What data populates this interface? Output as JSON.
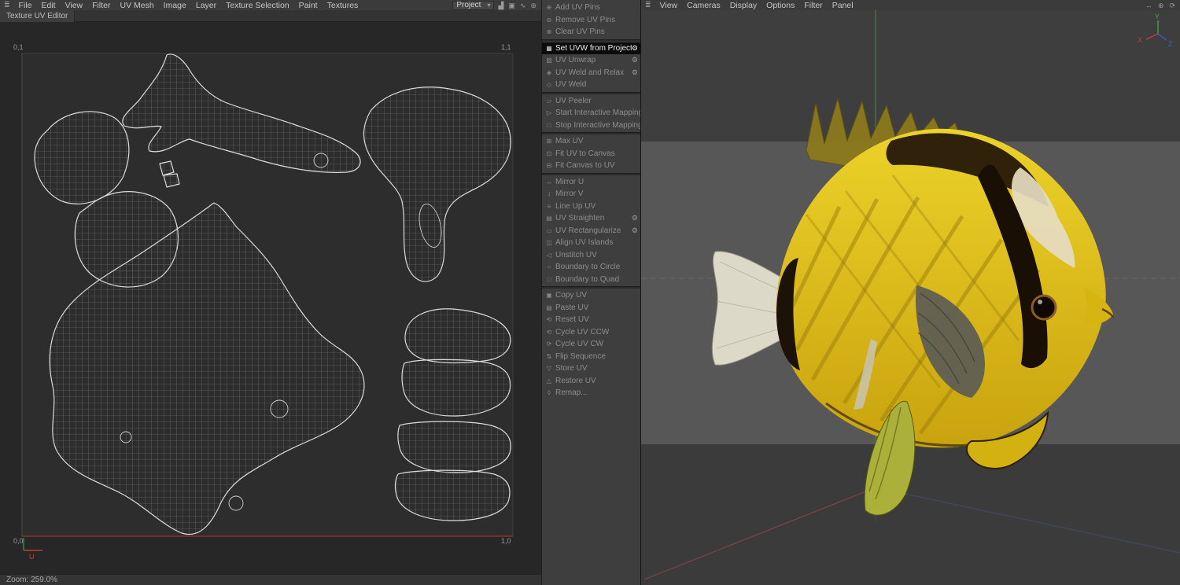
{
  "uv_editor": {
    "menubar": {
      "hamburger_icon": "≣",
      "items": [
        "File",
        "Edit",
        "View",
        "Filter",
        "UV Mesh",
        "Image",
        "Layer",
        "Texture Selection",
        "Paint",
        "Textures"
      ],
      "project_dropdown": {
        "value": "Project",
        "caret": "▾"
      },
      "right_icons": [
        {
          "name": "histogram-icon",
          "glyph": "▟"
        },
        {
          "name": "lock-icon",
          "glyph": "▣"
        },
        {
          "name": "pan-hand-icon",
          "glyph": "∿"
        },
        {
          "name": "snap-icon",
          "glyph": "⊕"
        }
      ]
    },
    "tab_label": "Texture UV Editor",
    "canvas": {
      "corner_top_left": "0,1",
      "corner_top_right": "1,1",
      "corner_bottom_left": "0,0",
      "corner_bottom_right": "1,0",
      "axis_u_label": "U"
    },
    "status_zoom": "Zoom: 259.0%"
  },
  "command_panel": {
    "gear_glyph": "⚙",
    "items": [
      {
        "label": "Add UV Pins",
        "icon": "⊕",
        "enabled": false
      },
      {
        "label": "Remove UV Pins",
        "icon": "⊖",
        "enabled": false
      },
      {
        "label": "Clear UV Pins",
        "icon": "⊗",
        "enabled": false
      },
      {
        "sep": true
      },
      {
        "label": "Set UVW from Projection",
        "icon": "▦",
        "enabled": true,
        "selected": true,
        "gear": true
      },
      {
        "label": "UV Unwrap",
        "icon": "▨",
        "enabled": false,
        "gear": true
      },
      {
        "label": "UV Weld and Relax",
        "icon": "◈",
        "enabled": false,
        "gear": true
      },
      {
        "label": "UV Weld",
        "icon": "◇",
        "enabled": false
      },
      {
        "sep": true
      },
      {
        "label": "UV Peeler",
        "icon": "▱",
        "enabled": false
      },
      {
        "label": "Start Interactive Mapping",
        "icon": "▷",
        "enabled": false
      },
      {
        "label": "Stop Interactive Mapping",
        "icon": "□",
        "enabled": false
      },
      {
        "sep": true
      },
      {
        "label": "Max UV",
        "icon": "⊞",
        "enabled": false
      },
      {
        "label": "Fit UV to Canvas",
        "icon": "⊡",
        "enabled": false
      },
      {
        "label": "Fit Canvas to UV",
        "icon": "⊟",
        "enabled": false
      },
      {
        "sep": true
      },
      {
        "label": "Mirror U",
        "icon": "↔",
        "enabled": false
      },
      {
        "label": "Mirror V",
        "icon": "↕",
        "enabled": false
      },
      {
        "label": "Line Up UV",
        "icon": "≡",
        "enabled": false
      },
      {
        "label": "UV Straighten",
        "icon": "▤",
        "enabled": false,
        "gear": true
      },
      {
        "label": "UV Rectangularize",
        "icon": "▭",
        "enabled": false,
        "gear": true
      },
      {
        "label": "Align UV Islands",
        "icon": "◫",
        "enabled": false
      },
      {
        "label": "Unstitch UV",
        "icon": "◁",
        "enabled": false
      },
      {
        "label": "Boundary to Circle",
        "icon": "○",
        "enabled": false
      },
      {
        "label": "Boundary to Quad",
        "icon": "□",
        "enabled": false
      },
      {
        "sep": true
      },
      {
        "label": "Copy UV",
        "icon": "▣",
        "enabled": false
      },
      {
        "label": "Paste UV",
        "icon": "▤",
        "enabled": false
      },
      {
        "label": "Reset UV",
        "icon": "⟲",
        "enabled": false
      },
      {
        "label": "Cycle UV CCW",
        "icon": "⟲",
        "enabled": false
      },
      {
        "label": "Cycle UV CW",
        "icon": "⟳",
        "enabled": false
      },
      {
        "label": "Flip Sequence",
        "icon": "⇅",
        "enabled": false
      },
      {
        "label": "Store UV",
        "icon": "▽",
        "enabled": false
      },
      {
        "label": "Restore UV",
        "icon": "△",
        "enabled": false
      },
      {
        "label": "Remap...",
        "icon": "◊",
        "enabled": false
      }
    ]
  },
  "viewport": {
    "menubar": {
      "hamburger_icon": "≣",
      "items": [
        "View",
        "Cameras",
        "Display",
        "Options",
        "Filter",
        "Panel"
      ],
      "right_icons": [
        {
          "name": "pan-icon",
          "glyph": "↔"
        },
        {
          "name": "zoom-icon",
          "glyph": "⊕"
        },
        {
          "name": "orbit-icon",
          "glyph": "⟳"
        }
      ]
    },
    "axis_gizmo": {
      "x": "X",
      "y": "Y",
      "z": "Z"
    }
  },
  "colors": {
    "selection_bg": "#0c0c0c",
    "uv_axis_red": "#a03228",
    "axis_green": "#4a9a4a",
    "axis_red": "#9a4a4a",
    "axis_blue": "#4a5a9a",
    "fish_yellow": "#e2c114"
  }
}
